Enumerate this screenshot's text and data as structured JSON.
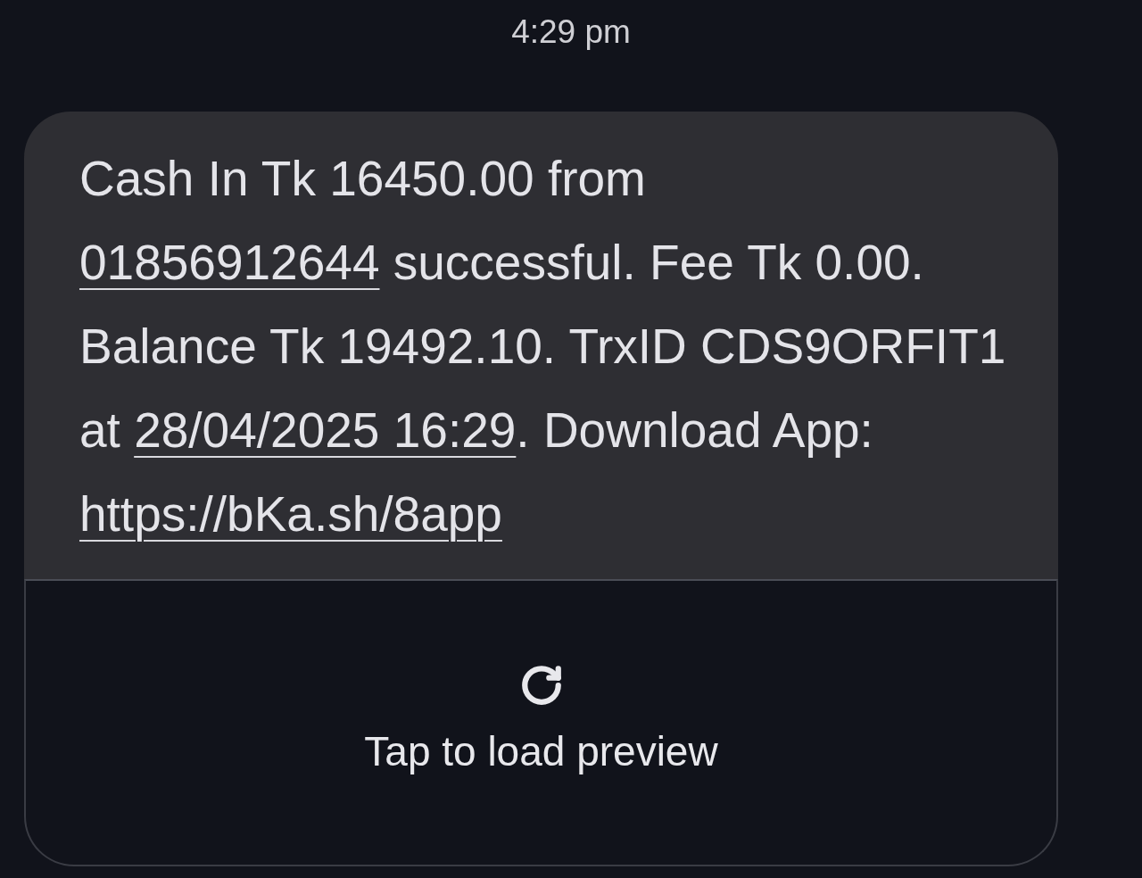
{
  "timestamp": "4:29 pm",
  "message": {
    "lines": [
      [
        {
          "kind": "text",
          "text": "Cash In Tk 16450.00 from"
        }
      ],
      [
        {
          "kind": "link",
          "text": "01856912644"
        },
        {
          "kind": "text",
          "text": " successful. Fee Tk 0.00."
        }
      ],
      [
        {
          "kind": "text",
          "text": "Balance Tk 19492.10. TrxID CDS9ORFIT1"
        }
      ],
      [
        {
          "kind": "text",
          "text": "at "
        },
        {
          "kind": "link",
          "text": "28/04/2025 16:29"
        },
        {
          "kind": "text",
          "text": ". Download App:"
        }
      ],
      [
        {
          "kind": "link",
          "text": "https://bKa.sh/8app"
        }
      ]
    ]
  },
  "preview": {
    "label": "Tap to load preview"
  }
}
